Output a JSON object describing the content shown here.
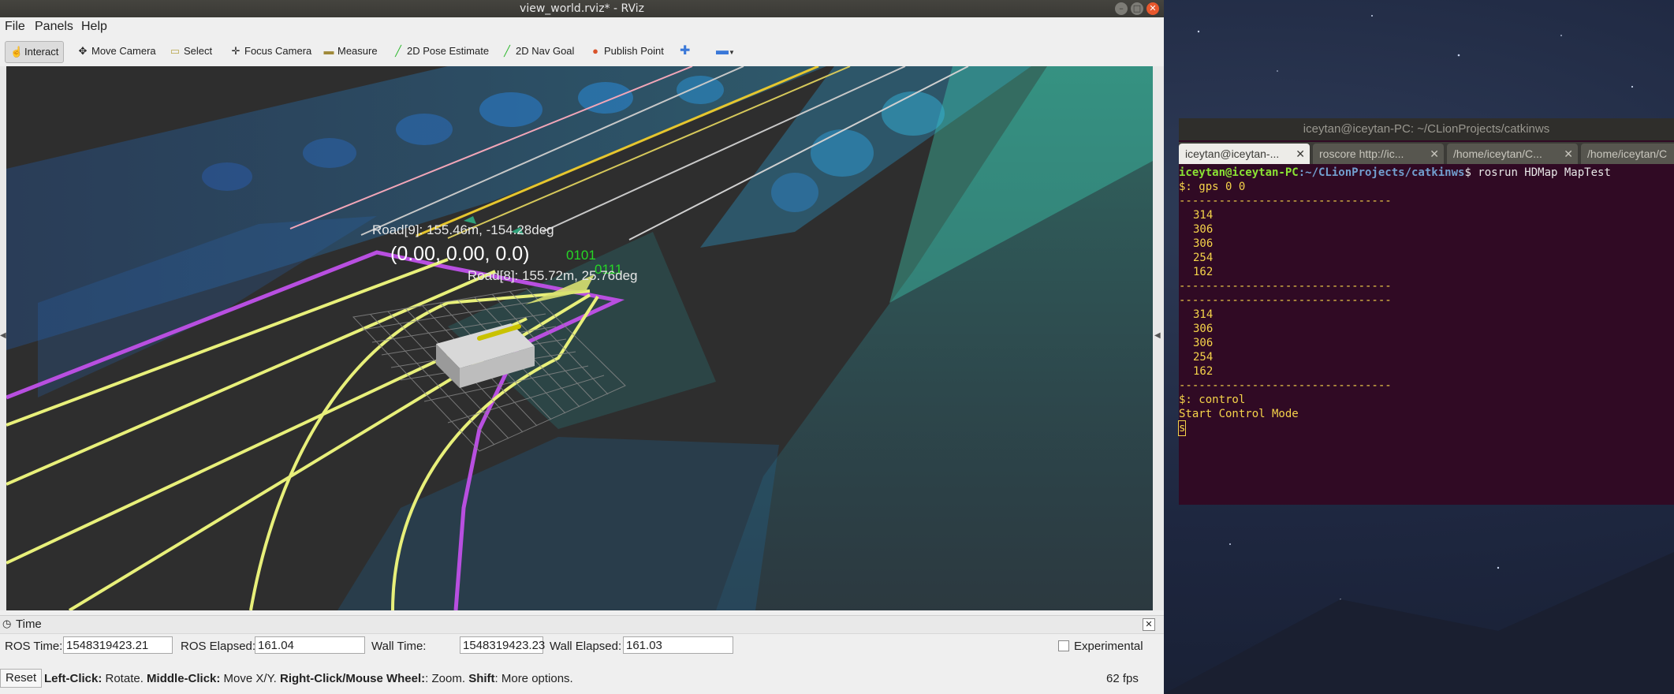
{
  "window": {
    "title": "view_world.rviz* - RViz"
  },
  "menu": [
    "File",
    "Panels",
    "Help"
  ],
  "toolbar": {
    "interact": "Interact",
    "move_camera": "Move Camera",
    "select": "Select",
    "focus_camera": "Focus Camera",
    "measure": "Measure",
    "pose_estimate": "2D Pose Estimate",
    "nav_goal": "2D Nav Goal",
    "publish_point": "Publish Point"
  },
  "viewport": {
    "road9": "Road[9]:  155.46m,  -154.28deg",
    "origin": "(0.00,  0.00,  0.0)",
    "code1": "0101",
    "code2": "0111",
    "road8": "Road[8]:  155.72m,  25.76deg"
  },
  "time_panel": {
    "title": "Time",
    "ros_time_label": "ROS Time:",
    "ros_time": "1548319423.21",
    "ros_elapsed_label": "ROS Elapsed:",
    "ros_elapsed": "161.04",
    "wall_time_label": "Wall Time:",
    "wall_time": "1548319423.23",
    "wall_elapsed_label": "Wall Elapsed:",
    "wall_elapsed": "161.03",
    "experimental": "Experimental"
  },
  "status": {
    "reset": "Reset",
    "left_click": "Left-Click:",
    "left_click_desc": " Rotate. ",
    "middle_click": "Middle-Click:",
    "middle_click_desc": " Move X/Y. ",
    "right_click": "Right-Click/Mouse Wheel:",
    "right_click_desc": ": Zoom. ",
    "shift": "Shift",
    "shift_desc": ": More options.",
    "fps": "62 fps"
  },
  "terminal": {
    "title": "iceytan@iceytan-PC: ~/CLionProjects/catkinws",
    "tabs": [
      "iceytan@iceytan-...",
      "roscore http://ic...",
      "/home/iceytan/C...",
      "/home/iceytan/C"
    ],
    "prompt_user": "iceytan@iceytan-PC",
    "prompt_path": ":~/CLionProjects/catkinws",
    "command": "$ rosrun HDMap MapTest",
    "gps_line": "$: gps 0 0",
    "dashes": "--------------------------------",
    "block1": [
      "314",
      "306",
      "306",
      "254",
      "162"
    ],
    "block2": [
      "314",
      "306",
      "306",
      "254",
      "162"
    ],
    "control_line": "$: control",
    "mode_line": "Start Control Mode",
    "cursor_char": "s"
  },
  "colors": {
    "lane_yellow": "#e8f07a",
    "road_magenta": "#b84fe0",
    "terminal_bg": "#300a24",
    "prompt_green": "#8ae234",
    "path_blue": "#729fcf",
    "output_yellow": "#f5d34a"
  }
}
